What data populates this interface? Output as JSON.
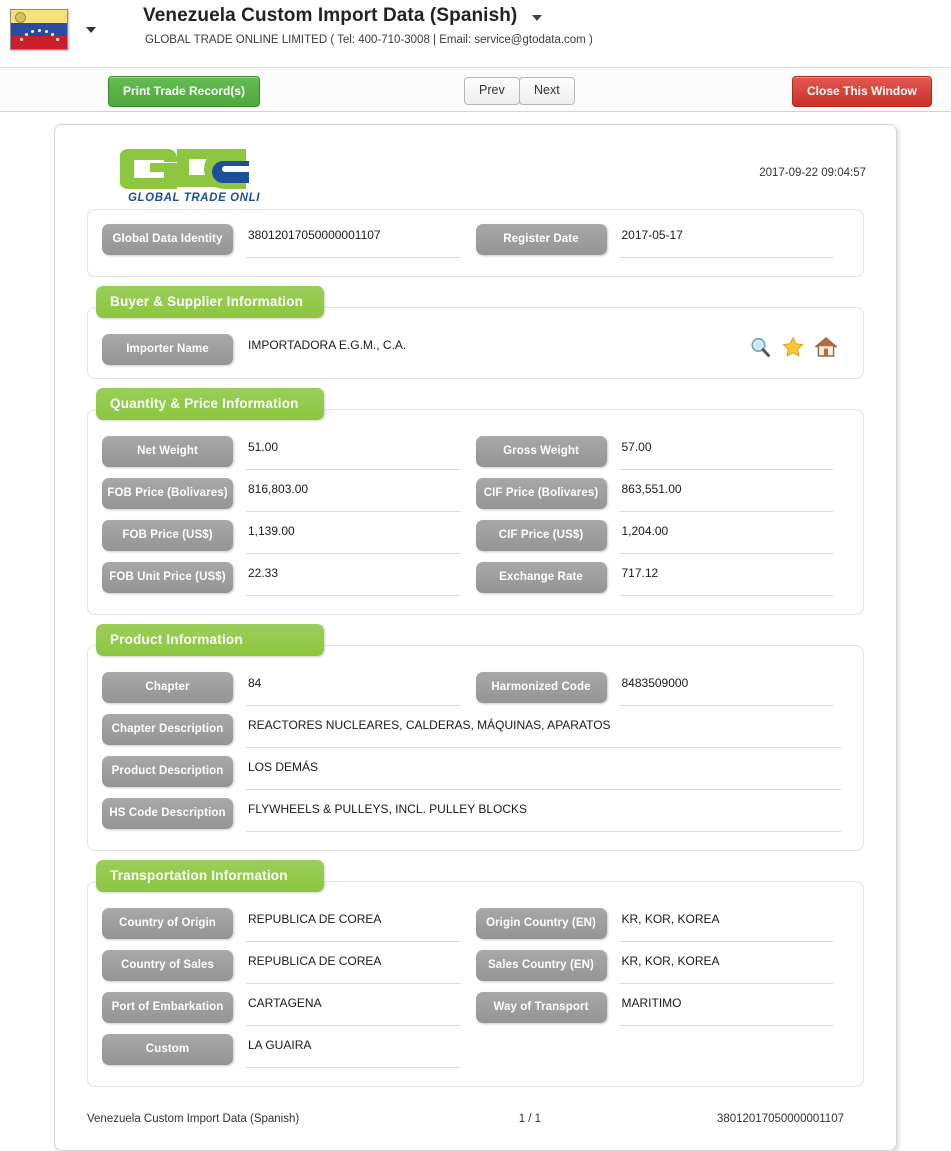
{
  "header": {
    "flag_icon": "venezuela-flag-icon",
    "locale_caret_icon": "chevron-down-icon",
    "title": "Venezuela Custom Import Data (Spanish)",
    "title_caret_icon": "chevron-down-icon",
    "subtitle": "GLOBAL TRADE ONLINE LIMITED ( Tel: 400-710-3008  |  Email: service@gtodata.com )"
  },
  "toolbar": {
    "print_label": "Print Trade Record(s)",
    "prev_label": "Prev",
    "next_label": "Next",
    "close_label": "Close This Window"
  },
  "document": {
    "logo_text": "GLOBAL TRADE  ONLINE LIMITED",
    "generated_at": "2017-09-22 09:04:57",
    "identity": {
      "fields": [
        {
          "label": "Global Data Identity",
          "value": "38012017050000001107"
        },
        {
          "label": "Register Date",
          "value": "2017-05-17"
        }
      ]
    },
    "buyer_supplier": {
      "title": "Buyer & Supplier Information",
      "importer_label": "Importer Name",
      "importer_value": "IMPORTADORA E.G.M., C.A.",
      "actions": [
        {
          "name": "search-icon",
          "title": "search"
        },
        {
          "name": "star-icon",
          "title": "favorite"
        },
        {
          "name": "home-icon",
          "title": "home"
        }
      ]
    },
    "quantity_price": {
      "title": "Quantity & Price Information",
      "fields": [
        {
          "label": "Net Weight",
          "value": "51.00"
        },
        {
          "label": "Gross Weight",
          "value": "57.00"
        },
        {
          "label": "FOB Price (Bolivares)",
          "value": "816,803.00"
        },
        {
          "label": "CIF Price (Bolivares)",
          "value": "863,551.00"
        },
        {
          "label": "FOB Price (US$)",
          "value": "1,139.00"
        },
        {
          "label": "CIF Price (US$)",
          "value": "1,204.00"
        },
        {
          "label": "FOB Unit Price (US$)",
          "value": "22.33"
        },
        {
          "label": "Exchange Rate",
          "value": "717.12"
        }
      ]
    },
    "product": {
      "title": "Product Information",
      "fields": [
        {
          "label": "Chapter",
          "value": "84"
        },
        {
          "label": "Harmonized Code",
          "value": "8483509000"
        }
      ],
      "full_fields": [
        {
          "label": "Chapter Description",
          "value": "REACTORES NUCLEARES, CALDERAS, MÁQUINAS, APARATOS"
        },
        {
          "label": "Product Description",
          "value": "LOS DEMÁS"
        },
        {
          "label": "HS Code Description",
          "value": "FLYWHEELS & PULLEYS, INCL. PULLEY BLOCKS"
        }
      ]
    },
    "transportation": {
      "title": "Transportation Information",
      "fields": [
        {
          "label": "Country of Origin",
          "value": "REPUBLICA DE COREA"
        },
        {
          "label": "Origin Country (EN)",
          "value": "KR, KOR, KOREA"
        },
        {
          "label": "Country of Sales",
          "value": "REPUBLICA DE COREA"
        },
        {
          "label": "Sales Country (EN)",
          "value": "KR, KOR, KOREA"
        },
        {
          "label": "Port of Embarkation",
          "value": "CARTAGENA"
        },
        {
          "label": "Way of Transport",
          "value": "MARITIMO"
        },
        {
          "label": "Custom",
          "value": "LA GUAIRA"
        }
      ]
    },
    "footer": {
      "left": "Venezuela Custom Import Data (Spanish)",
      "page": "1 / 1",
      "right": "38012017050000001107"
    }
  },
  "colors": {
    "brand_green": "#8cc63f",
    "print_green": "#4fa83c",
    "close_red": "#cc2f27",
    "pill_gray": "#949494",
    "logo_green": "#8dc63f",
    "logo_blue": "#1c4e9c"
  }
}
